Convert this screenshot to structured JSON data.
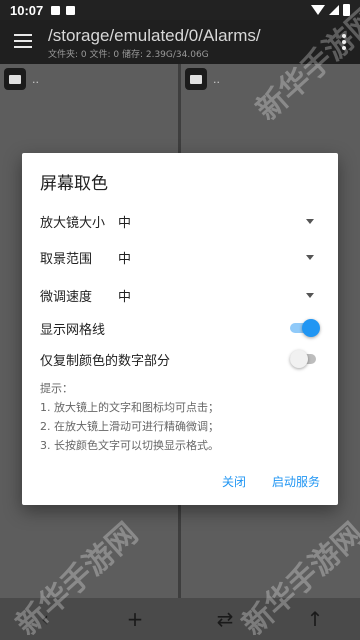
{
  "status_bar": {
    "time": "10:07"
  },
  "app_bar": {
    "path": "/storage/emulated/0/Alarms/",
    "info": "文件夹: 0  文件: 0  储存: 2.39G/34.06G"
  },
  "panes": {
    "left_item": "..",
    "right_item": ".."
  },
  "dialog": {
    "title": "屏幕取色",
    "rows": [
      {
        "label": "放大镜大小",
        "value": "中"
      },
      {
        "label": "取景范围",
        "value": "中"
      },
      {
        "label": "微调速度",
        "value": "中"
      }
    ],
    "toggles": [
      {
        "label": "显示网格线",
        "on": true
      },
      {
        "label": "仅复制颜色的数字部分",
        "on": false
      }
    ],
    "tips": {
      "heading": "提示：",
      "lines": [
        "1. 放大镜上的文字和图标均可点击；",
        "2. 在放大镜上滑动可进行精确微调；",
        "3. 长按颜色文字可以切换显示格式。"
      ]
    },
    "actions": {
      "close": "关闭",
      "start": "启动服务"
    }
  },
  "bottom_bar": {
    "back": "‹",
    "add": "+",
    "swap": "⇄",
    "up": "↑"
  },
  "colors": {
    "accent": "#2196f3"
  },
  "watermark": "新华手游网"
}
